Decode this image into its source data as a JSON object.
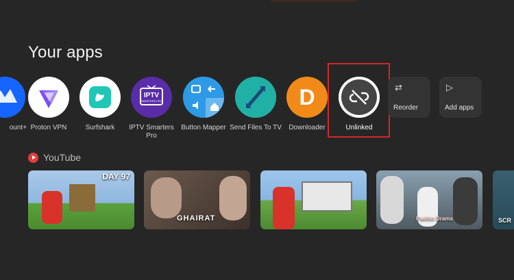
{
  "section": {
    "title": "Your apps"
  },
  "apps": [
    {
      "label": "ount+",
      "icon": "paramount-plus-icon"
    },
    {
      "label": "Proton VPN",
      "icon": "proton-vpn-icon"
    },
    {
      "label": "Surfshark",
      "icon": "surfshark-icon"
    },
    {
      "label": "IPTV Smarters Pro",
      "icon": "iptv-smarters-pro-icon",
      "icon_text": "IPTV",
      "icon_subtext": "SMARTERS PRO"
    },
    {
      "label": "Button Mapper",
      "icon": "button-mapper-icon"
    },
    {
      "label": "Send Files To TV",
      "icon": "send-files-to-tv-icon"
    },
    {
      "label": "Downloader",
      "icon": "downloader-icon",
      "icon_text": "D"
    },
    {
      "label": "Unlinked",
      "icon": "unlinked-icon"
    }
  ],
  "tiles": [
    {
      "label": "Reorder",
      "icon": "⇄"
    },
    {
      "label": "Add apps",
      "icon": "▷"
    }
  ],
  "youtube": {
    "title": "YouTube",
    "thumbnails": [
      {
        "overlay": "DAY 97"
      },
      {
        "overlay": "GHAIRAT"
      },
      {
        "overlay": ""
      },
      {
        "overlay": "Pashto Drama"
      },
      {
        "overlay": "SCR"
      }
    ]
  },
  "colors": {
    "background": "#262626",
    "focus": "#d4262a",
    "youtube_red": "#e23d3d"
  }
}
